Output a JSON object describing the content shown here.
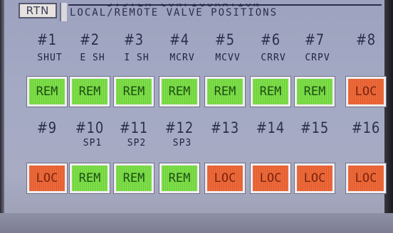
{
  "header": {
    "rtn_label": "RTN",
    "title_top": "SYSTEM CONFIGURATION",
    "title_main": "LOCAL/REMOTE VALVE POSITIONS"
  },
  "colors": {
    "remote": "#7fde4a",
    "local": "#ec6a3a",
    "background": "#a4a9c4"
  },
  "valves": [
    {
      "number": "#1",
      "label": "SHUT",
      "state": "REM"
    },
    {
      "number": "#2",
      "label": "E SH",
      "state": "REM"
    },
    {
      "number": "#3",
      "label": "I SH",
      "state": "REM"
    },
    {
      "number": "#4",
      "label": "MCRV",
      "state": "REM"
    },
    {
      "number": "#5",
      "label": "MCVV",
      "state": "REM"
    },
    {
      "number": "#6",
      "label": "CRRV",
      "state": "REM"
    },
    {
      "number": "#7",
      "label": "CRPV",
      "state": "REM"
    },
    {
      "number": "#8",
      "label": "",
      "state": "LOC"
    },
    {
      "number": "#9",
      "label": "",
      "state": "LOC"
    },
    {
      "number": "#10",
      "label": "SP1",
      "state": "REM"
    },
    {
      "number": "#11",
      "label": "SP2",
      "state": "REM"
    },
    {
      "number": "#12",
      "label": "SP3",
      "state": "REM"
    },
    {
      "number": "#13",
      "label": "",
      "state": "LOC"
    },
    {
      "number": "#14",
      "label": "",
      "state": "LOC"
    },
    {
      "number": "#15",
      "label": "",
      "state": "LOC"
    },
    {
      "number": "#16",
      "label": "",
      "state": "LOC"
    }
  ]
}
